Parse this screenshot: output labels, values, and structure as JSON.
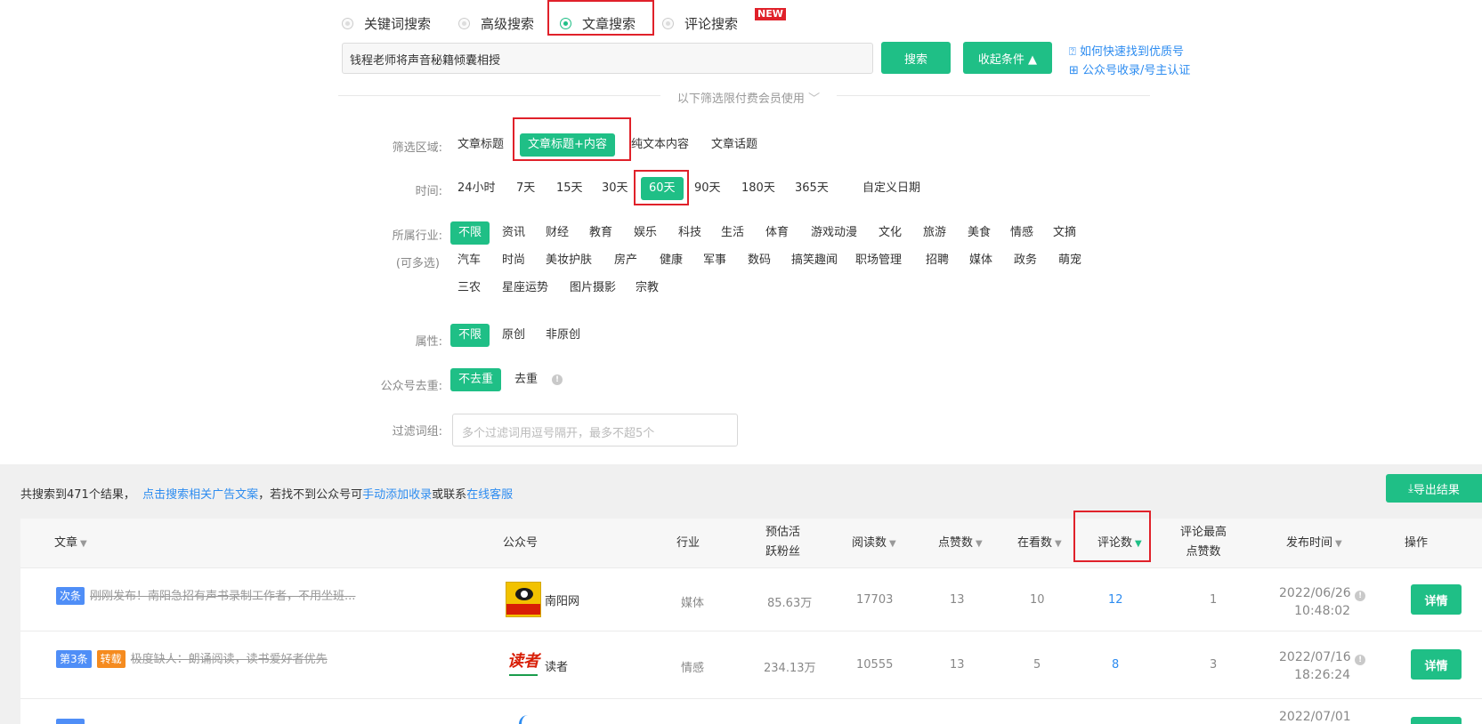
{
  "search_type": {
    "options": [
      "关键词搜索",
      "高级搜索",
      "文章搜索",
      "评论搜索"
    ],
    "selected": "文章搜索",
    "new_badge": "NEW"
  },
  "search": {
    "query": "钱程老师将声音秘籍倾囊相授",
    "search_button": "搜索",
    "collapse_button": "收起条件 ▲"
  },
  "help_links": {
    "find_quality": "如何快速找到优质号",
    "add_account": "公众号收录/号主认证"
  },
  "paid_notice": "以下筛选限付费会员使用",
  "filters": {
    "area": {
      "label": "筛选区域:",
      "options": [
        "文章标题",
        "文章标题+内容",
        "纯文本内容",
        "文章话题"
      ],
      "selected": "文章标题+内容"
    },
    "time": {
      "label": "时间:",
      "options": [
        "24小时",
        "7天",
        "15天",
        "30天",
        "60天",
        "90天",
        "180天",
        "365天",
        "自定义日期"
      ],
      "selected": "60天"
    },
    "industry": {
      "label": "所属行业:",
      "sublabel": "(可多选)",
      "row1": [
        "不限",
        "资讯",
        "财经",
        "教育",
        "娱乐",
        "科技",
        "生活",
        "体育",
        "游戏动漫",
        "文化",
        "旅游",
        "美食",
        "情感",
        "文摘"
      ],
      "row2": [
        "汽车",
        "时尚",
        "美妆护肤",
        "房产",
        "健康",
        "军事",
        "数码",
        "搞笑趣闻",
        "职场管理",
        "招聘",
        "媒体",
        "政务",
        "萌宠"
      ],
      "row3": [
        "三农",
        "星座运势",
        "图片摄影",
        "宗教"
      ],
      "selected": "不限"
    },
    "attribute": {
      "label": "属性:",
      "options": [
        "不限",
        "原创",
        "非原创"
      ],
      "selected": "不限"
    },
    "dedupe": {
      "label": "公众号去重:",
      "options": [
        "不去重",
        "去重"
      ],
      "selected": "不去重"
    },
    "filter_words": {
      "label": "过滤词组:",
      "placeholder": "多个过滤词用逗号隔开，最多不超5个"
    }
  },
  "summary": {
    "prefix": "共搜索到471个结果，",
    "ad_link": "点击搜索相关广告文案",
    "middle": "，若找不到公众号可",
    "add_link": "手动添加收录",
    "or": "或联系",
    "service_link": "在线客服"
  },
  "export_button": "导出结果",
  "table": {
    "headers": {
      "article": "文章",
      "account": "公众号",
      "industry": "行业",
      "fans_1": "预估活",
      "fans_2": "跃粉丝",
      "reads": "阅读数",
      "likes": "点赞数",
      "watching": "在看数",
      "comments": "评论数",
      "top_like_1": "评论最高",
      "top_like_2": "点赞数",
      "publish_time": "发布时间",
      "action": "操作"
    },
    "rows": [
      {
        "tags": [
          "次条"
        ],
        "title": "刚刚发布！南阳急招有声书录制工作者，不用坐班...",
        "account": "南阳网",
        "industry": "媒体",
        "fans": "85.63万",
        "reads": "17703",
        "likes": "13",
        "watching": "10",
        "comments": "12",
        "top_like": "1",
        "date": "2022/06/26",
        "time": "10:48:02",
        "action": "详情"
      },
      {
        "tags": [
          "第3条",
          "转载"
        ],
        "title": "极度缺人：朗诵阅读，读书爱好者优先",
        "account": "读者",
        "industry": "情感",
        "fans": "234.13万",
        "reads": "10555",
        "likes": "13",
        "watching": "5",
        "comments": "8",
        "top_like": "3",
        "date": "2022/07/16",
        "time": "18:26:24",
        "action": "详情"
      },
      {
        "date": "2022/07/01"
      }
    ]
  },
  "colors": {
    "accent": "#1fbf86",
    "highlight_box": "#e0212a",
    "link": "#2d8cf0"
  }
}
